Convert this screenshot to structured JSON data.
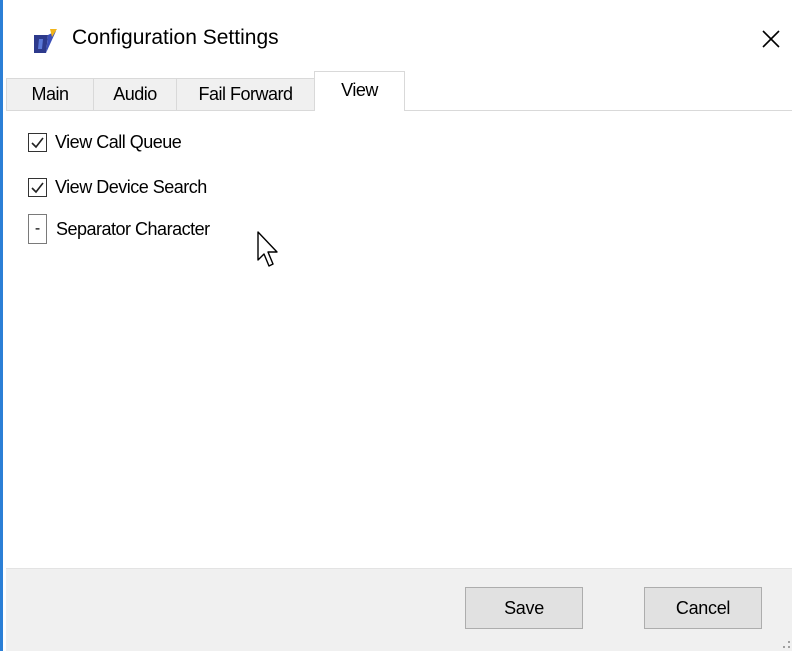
{
  "window": {
    "title": "Configuration Settings",
    "app_icon": "app-logo-icon",
    "close_icon": "close-icon"
  },
  "tabs": [
    {
      "label": "Main",
      "active": false
    },
    {
      "label": "Audio",
      "active": false
    },
    {
      "label": "Fail Forward",
      "active": false
    },
    {
      "label": "View",
      "active": true
    }
  ],
  "view": {
    "view_call_queue": {
      "label": "View Call Queue",
      "checked": true
    },
    "view_device_search": {
      "label": "View Device Search",
      "checked": true
    },
    "separator_character": {
      "label": "Separator Character",
      "value": "-"
    }
  },
  "footer": {
    "save_label": "Save",
    "cancel_label": "Cancel"
  },
  "colors": {
    "accent_border": "#2b7fd6",
    "footer_bg": "#f0f0f0",
    "button_bg": "#e1e1e1"
  }
}
